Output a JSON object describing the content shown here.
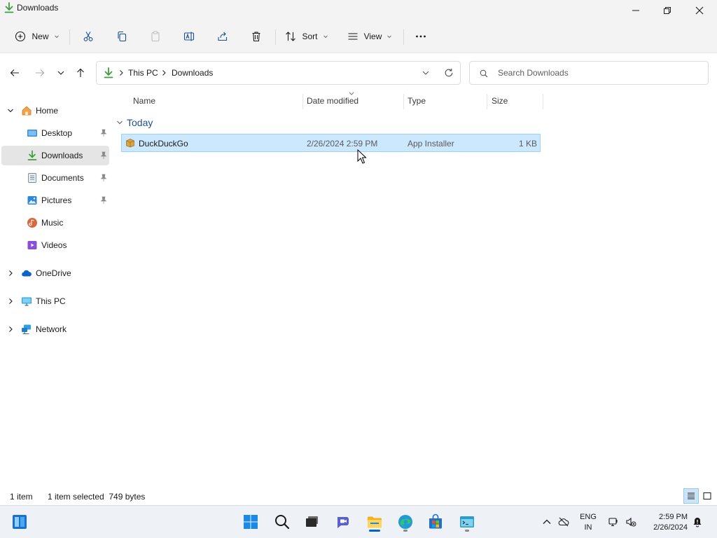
{
  "window": {
    "title": "Downloads",
    "controls": [
      "minimize-icon",
      "maximize-icon",
      "close-icon"
    ]
  },
  "toolbar": {
    "new_label": "New",
    "sort_label": "Sort",
    "view_label": "View",
    "icons": [
      "cut-icon",
      "copy-icon",
      "paste-icon",
      "rename-icon",
      "share-icon",
      "delete-icon",
      "more-icon"
    ]
  },
  "address": {
    "crumbs": [
      "This PC",
      "Downloads"
    ]
  },
  "search": {
    "placeholder": "Search Downloads"
  },
  "sidebar": {
    "items": [
      {
        "label": "Home",
        "icon": "home-icon",
        "expanded": true
      },
      {
        "label": "Desktop",
        "icon": "desktop-icon",
        "pinned": true
      },
      {
        "label": "Downloads",
        "icon": "download-icon",
        "pinned": true,
        "selected": true
      },
      {
        "label": "Documents",
        "icon": "documents-icon",
        "pinned": true
      },
      {
        "label": "Pictures",
        "icon": "pictures-icon",
        "pinned": true
      },
      {
        "label": "Music",
        "icon": "music-icon"
      },
      {
        "label": "Videos",
        "icon": "videos-icon"
      },
      {
        "label": "OneDrive",
        "icon": "onedrive-icon",
        "expanded": false
      },
      {
        "label": "This PC",
        "icon": "pc-icon",
        "expanded": false
      },
      {
        "label": "Network",
        "icon": "network-icon",
        "expanded": false
      }
    ]
  },
  "table": {
    "columns": [
      "Name",
      "Date modified",
      "Type",
      "Size"
    ],
    "group_label": "Today",
    "rows": [
      {
        "name": "DuckDuckGo",
        "date_modified": "2/26/2024 2:59 PM",
        "type": "App Installer",
        "size": "1 KB",
        "selected": true
      }
    ]
  },
  "status": {
    "item_count": "1 item",
    "selection": "1 item selected  749 bytes"
  },
  "taskbar": {
    "apps": [
      "start-icon",
      "search-icon",
      "task-view-icon",
      "chat-icon",
      "file-explorer-icon",
      "edge-icon",
      "store-icon",
      "terminal-icon"
    ],
    "lang_line1": "ENG",
    "lang_line2": "IN",
    "time": "2:59 PM",
    "date": "2/26/2024"
  },
  "colors": {
    "selection_fill": "#cce8ff",
    "selection_border": "#99d1ff",
    "accent": "#0067c0",
    "download_green": "#3d9e3d",
    "group_header": "#1f4f8f"
  }
}
